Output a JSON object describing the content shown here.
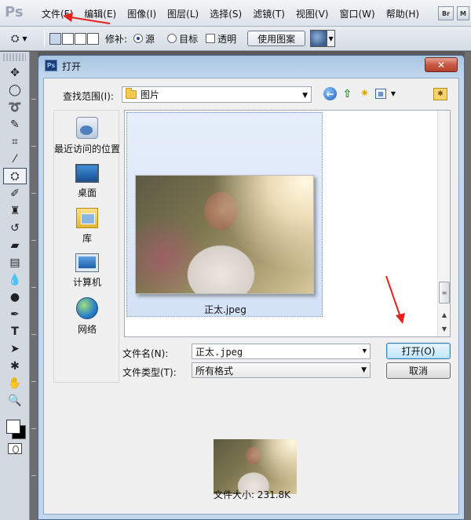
{
  "app": {
    "logo": "Ps",
    "menu": [
      "文件(F)",
      "编辑(E)",
      "图像(I)",
      "图层(L)",
      "选择(S)",
      "滤镜(T)",
      "视图(V)",
      "窗口(W)",
      "帮助(H)"
    ],
    "mini_buttons": [
      "Br",
      "M"
    ]
  },
  "options_bar": {
    "repair_label": "修补:",
    "source_label": "源",
    "destination_label": "目标",
    "transparent_label": "透明",
    "use_pattern_label": "使用图案"
  },
  "dialog": {
    "title_icon": "Ps",
    "title": "打开",
    "close": "✕",
    "look_in_label": "查找范围(I):",
    "look_in_value": "图片",
    "places": [
      {
        "label": "最近访问的位置",
        "icon": "recent-places-icon"
      },
      {
        "label": "桌面",
        "icon": "desktop-icon"
      },
      {
        "label": "库",
        "icon": "library-icon"
      },
      {
        "label": "计算机",
        "icon": "computer-icon"
      },
      {
        "label": "网络",
        "icon": "network-icon"
      }
    ],
    "file_item_name": "正太.jpeg",
    "file_name_label": "文件名(N):",
    "file_name_value": "正太.jpeg",
    "file_type_label": "文件类型(T):",
    "file_type_value": "所有格式",
    "open_button": "打开(O)",
    "cancel_button": "取消",
    "file_size": "文件大小: 231.8K"
  },
  "colors": {
    "annotation": "#e8201c",
    "dialog_frame": "#c1d6ec"
  }
}
